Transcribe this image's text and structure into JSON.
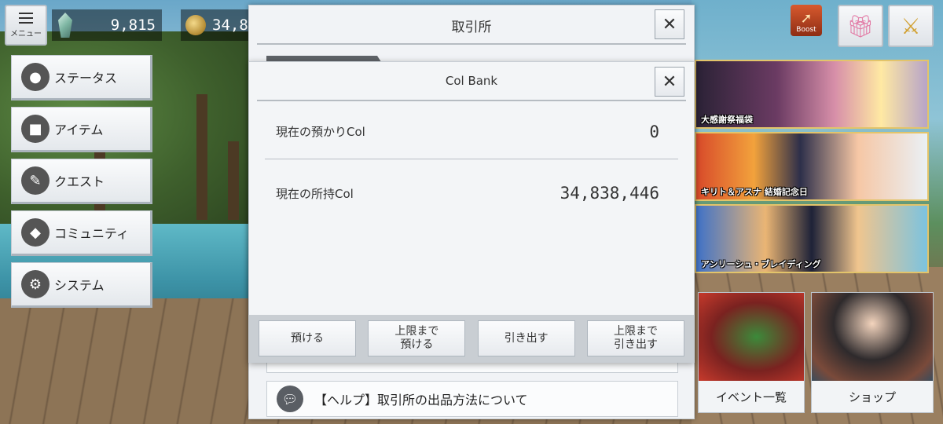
{
  "topbar": {
    "menu_label": "メニュー",
    "crystal_value": "9,815",
    "col_value_partial": "34,83"
  },
  "side_menu": {
    "items": [
      {
        "label": "ステータス",
        "icon": "person-icon"
      },
      {
        "label": "アイテム",
        "icon": "bag-icon"
      },
      {
        "label": "クエスト",
        "icon": "quest-scroll-icon"
      },
      {
        "label": "コミュニティ",
        "icon": "people-icon"
      },
      {
        "label": "システム",
        "icon": "gear-icon"
      }
    ]
  },
  "right": {
    "boost_label": "Boost",
    "banners": [
      {
        "caption": "大感謝祭福袋"
      },
      {
        "caption": "キリト＆アスナ 結婚記念日"
      },
      {
        "caption": "アンリーシュ・ブレイディング"
      }
    ],
    "event_label": "イベント一覧",
    "shop_label": "ショップ"
  },
  "exchange": {
    "title": "取引所",
    "help_text": "【ヘルプ】取引所の出品方法について"
  },
  "col_bank": {
    "title": "Col Bank",
    "deposit_label": "現在の預かりCol",
    "deposit_value": "0",
    "held_label": "現在の所持Col",
    "held_value": "34,838,446",
    "buttons": {
      "deposit": "預ける",
      "deposit_max": "上限まで\n預ける",
      "withdraw": "引き出す",
      "withdraw_max": "上限まで\n引き出す"
    }
  },
  "colors": {
    "panel_bg": "#f3f5f7",
    "footer_bg": "#c9ced3",
    "text": "#333333"
  }
}
